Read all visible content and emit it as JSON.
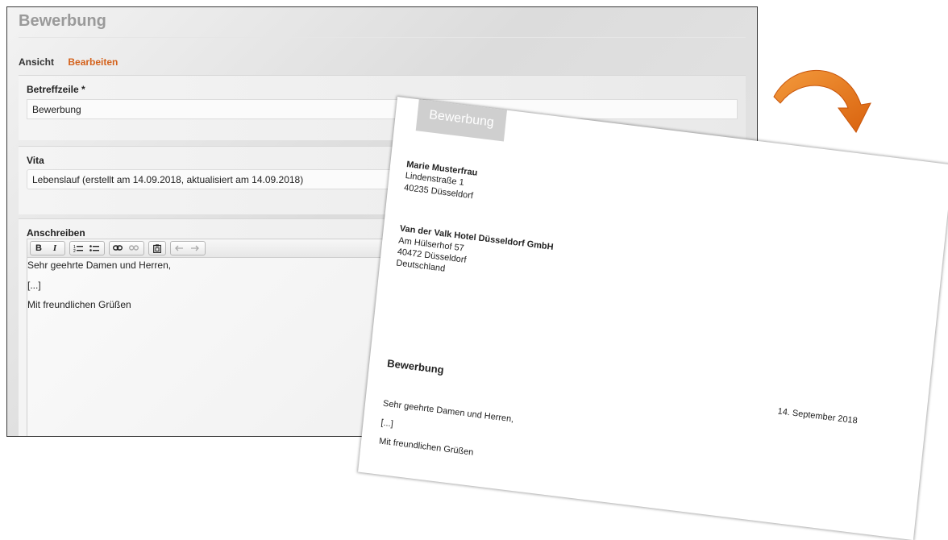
{
  "editor": {
    "title": "Bewerbung",
    "tabs": [
      {
        "label": "Ansicht",
        "active": false
      },
      {
        "label": "Bearbeiten",
        "active": true
      }
    ],
    "subject": {
      "label": "Betreffzeile *",
      "value": "Bewerbung"
    },
    "vita": {
      "label": "Vita",
      "value": "Lebenslauf (erstellt am 14.09.2018, aktualisiert am 14.09.2018)"
    },
    "letter": {
      "label": "Anschreiben",
      "toolbar": {
        "bold": "B",
        "italic": "I",
        "ordered_list": "1≡",
        "bullet_list": "•≡",
        "link": "⛓",
        "unlink": "⛓",
        "paste": "📋",
        "undo": "↶",
        "redo": "↷"
      },
      "body": [
        "Sehr geehrte Damen und Herren,",
        "[...]",
        "Mit freundlichen Grüßen"
      ]
    }
  },
  "colors": {
    "accent": "#d4621c",
    "arrow": "#e8781e",
    "title": "#9a9a9a"
  },
  "preview": {
    "logo_text": "Bewerbung",
    "sender": {
      "name": "Marie Musterfrau",
      "street": "Lindenstraße 1",
      "city": "40235 Düsseldorf"
    },
    "recipient": {
      "company": "Van der Valk Hotel Düsseldorf GmbH",
      "street": "Am Hülserhof 57",
      "city": "40472 Düsseldorf",
      "country": "Deutschland"
    },
    "subject": "Bewerbung",
    "date": "14. September 2018",
    "salutation": "Sehr geehrte Damen und Herren,",
    "body": "[...]",
    "closing": "Mit freundlichen Grüßen"
  }
}
